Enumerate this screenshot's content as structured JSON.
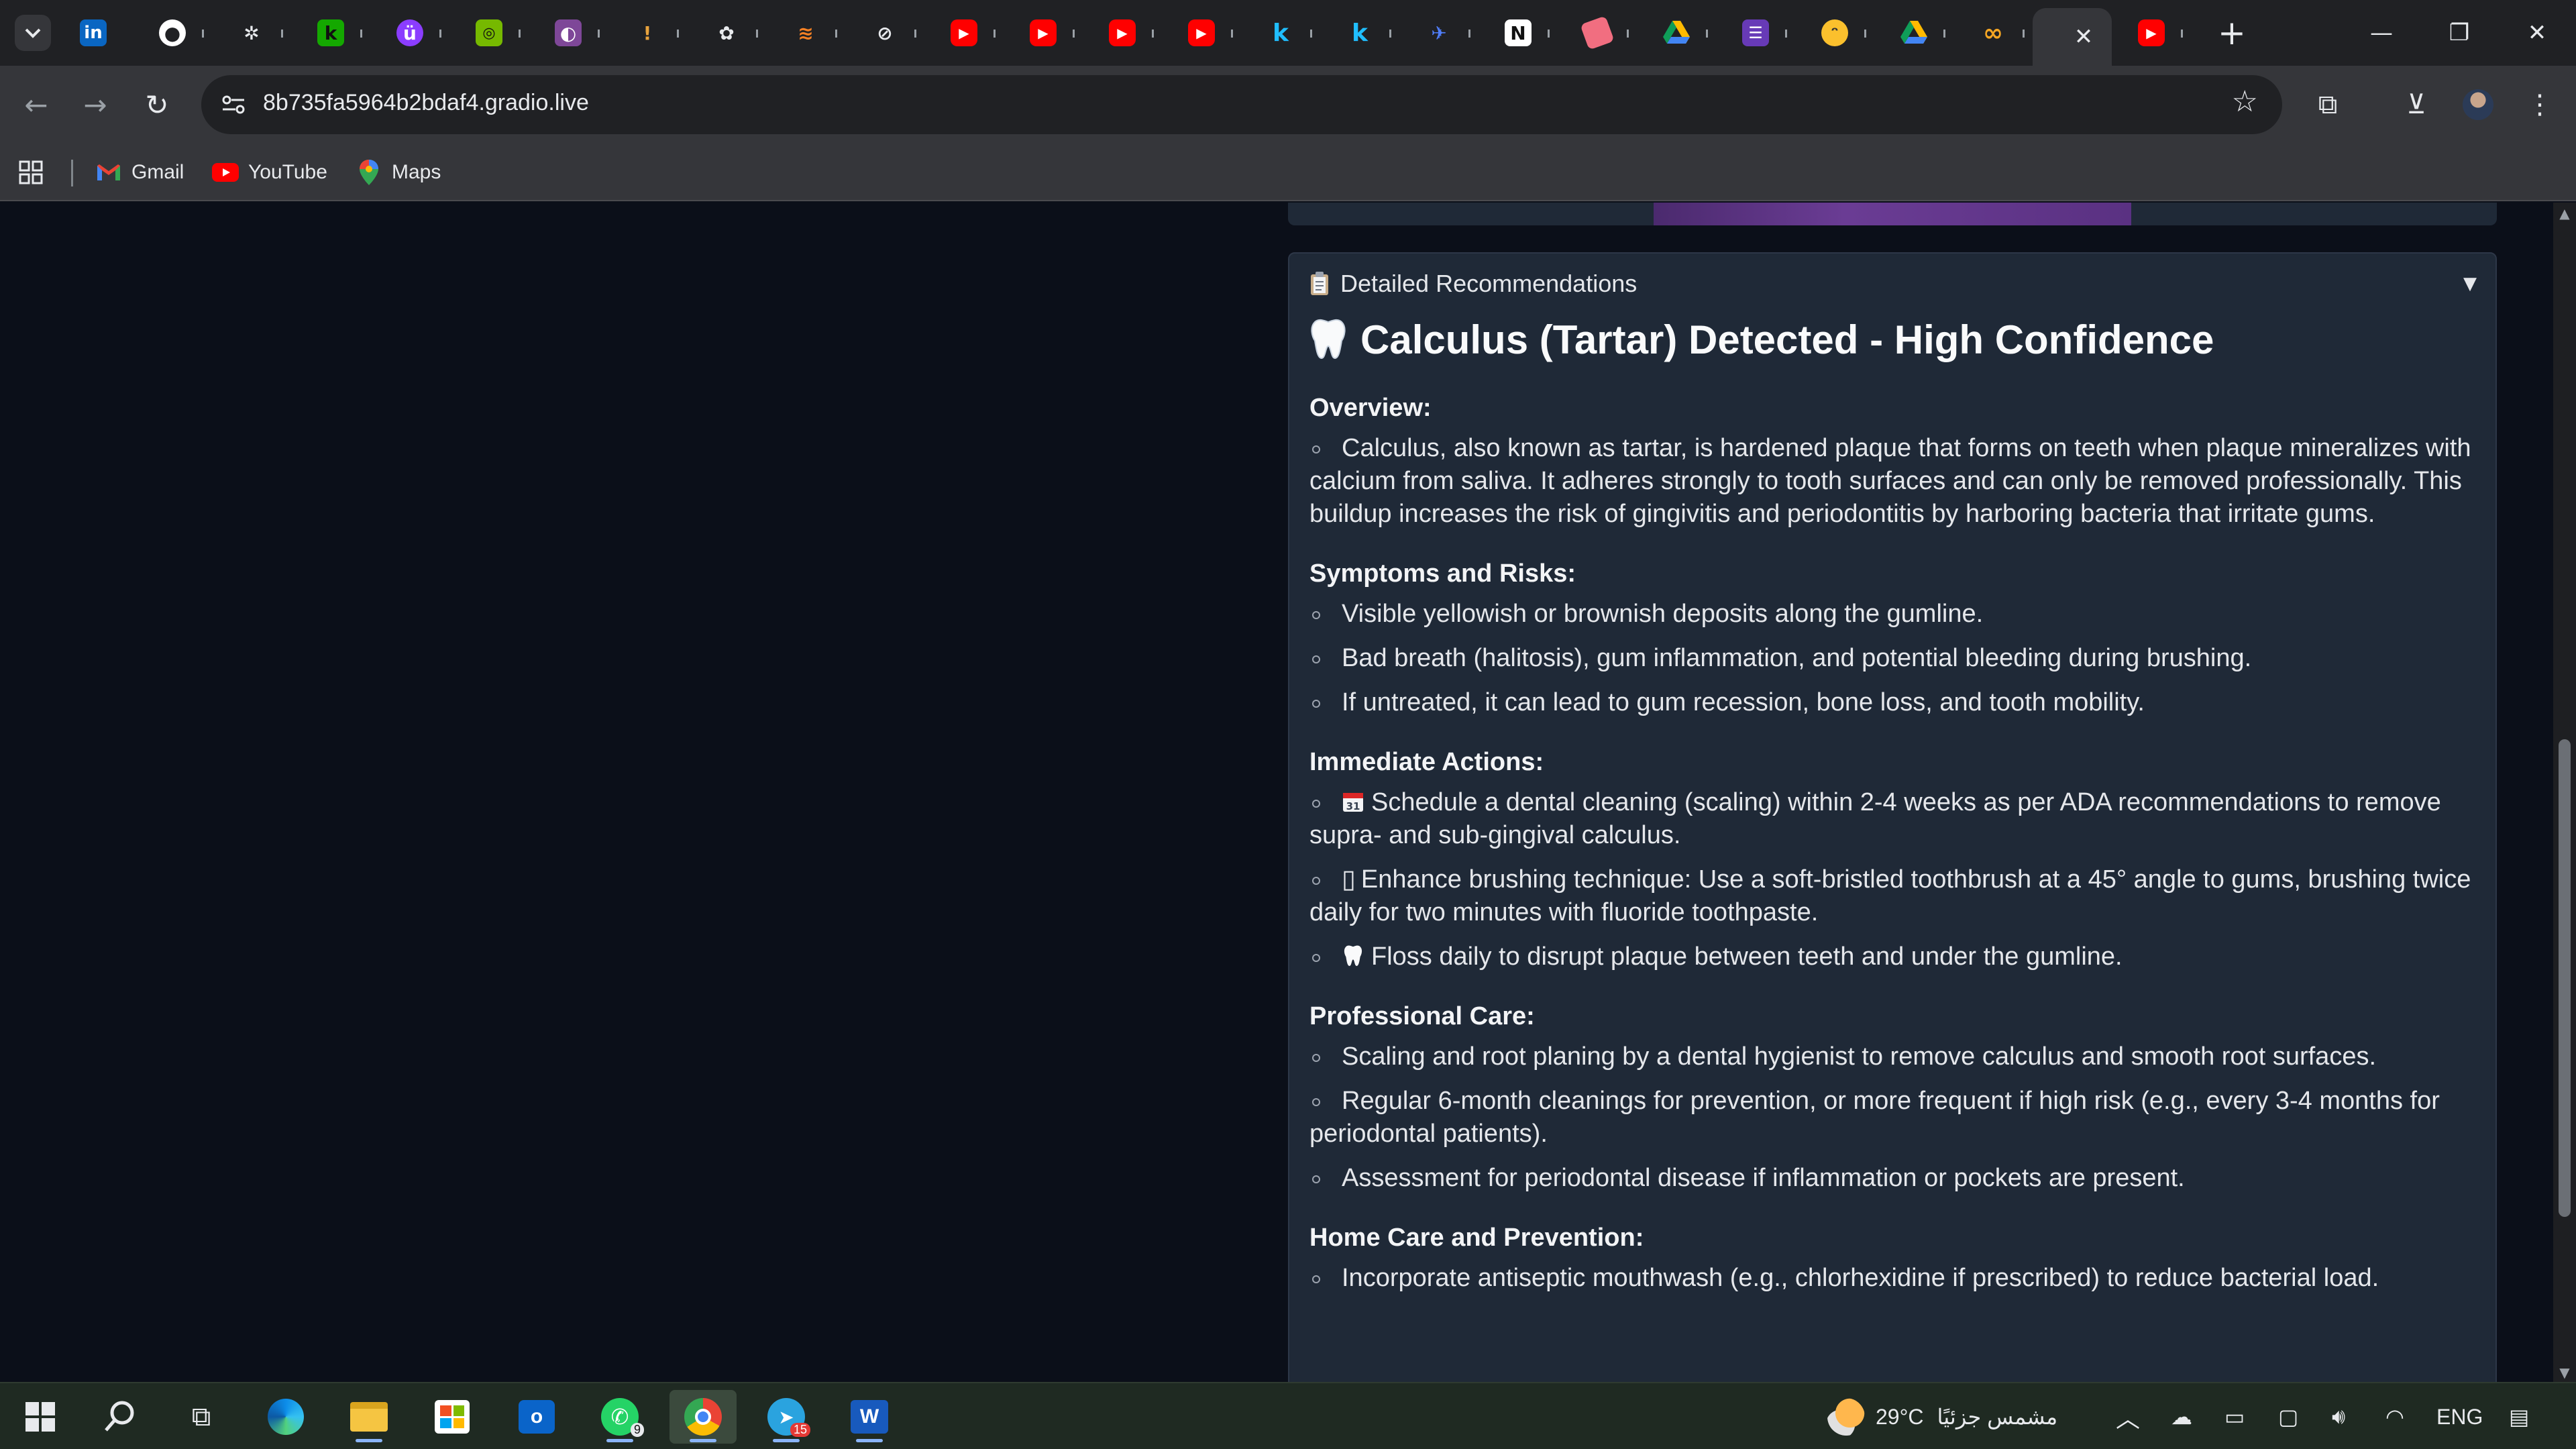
{
  "browser": {
    "url": "8b735fa5964b2bdaf4.gradio.live",
    "bookmarks": [
      {
        "label": "Gmail"
      },
      {
        "label": "YouTube"
      },
      {
        "label": "Maps"
      }
    ],
    "pinned_tabs": [
      "linkedin",
      "github",
      "bug",
      "upwork",
      "mauve",
      "nvidia",
      "tor",
      "torch",
      "openai",
      "stack",
      "notion-like",
      "youtube",
      "youtube",
      "youtube",
      "youtube",
      "kaggle",
      "kaggle",
      "codeium",
      "notion",
      "eraser",
      "drive",
      "forms",
      "face",
      "drive",
      "coursera",
      "active",
      "youtube"
    ]
  },
  "panel": {
    "header": "Detailed Recommendations",
    "title": "Calculus (Tartar) Detected - High Confidence",
    "sections": {
      "overview": {
        "heading": "Overview:",
        "items": [
          "Calculus, also known as tartar, is hardened plaque that forms on teeth when plaque mineralizes with calcium from saliva. It adheres strongly to tooth surfaces and can only be removed professionally. This buildup increases the risk of gingivitis and periodontitis by harboring bacteria that irritate gums."
        ]
      },
      "symptoms": {
        "heading": "Symptoms and Risks:",
        "items": [
          "Visible yellowish or brownish deposits along the gumline.",
          "Bad breath (halitosis), gum inflammation, and potential bleeding during brushing.",
          "If untreated, it can lead to gum recession, bone loss, and tooth mobility."
        ]
      },
      "immediate": {
        "heading": "Immediate Actions:",
        "items": [
          "Schedule a dental cleaning (scaling) within 2-4 weeks as per ADA recommendations to remove supra- and sub-gingival calculus.",
          "Enhance brushing technique: Use a soft-bristled toothbrush at a 45° angle to gums, brushing twice daily for two minutes with fluoride toothpaste.",
          "Floss daily to disrupt plaque between teeth and under the gumline."
        ]
      },
      "professional": {
        "heading": "Professional Care:",
        "items": [
          "Scaling and root planing by a dental hygienist to remove calculus and smooth root surfaces.",
          "Regular 6-month cleanings for prevention, or more frequent if high risk (e.g., every 3-4 months for periodontal patients).",
          "Assessment for periodontal disease if inflammation or pockets are present."
        ]
      },
      "home": {
        "heading": "Home Care and Prevention:",
        "items": [
          "Incorporate antiseptic mouthwash (e.g., chlorhexidine if prescribed) to reduce bacterial load."
        ]
      }
    },
    "glyphs": {
      "missing_emoji": "▯"
    }
  },
  "taskbar": {
    "weather_temp": "29°C",
    "weather_text": "مشمس جزئيًا",
    "language": "ENG",
    "telegram_badge": "15",
    "whatsapp_badge": "9"
  }
}
